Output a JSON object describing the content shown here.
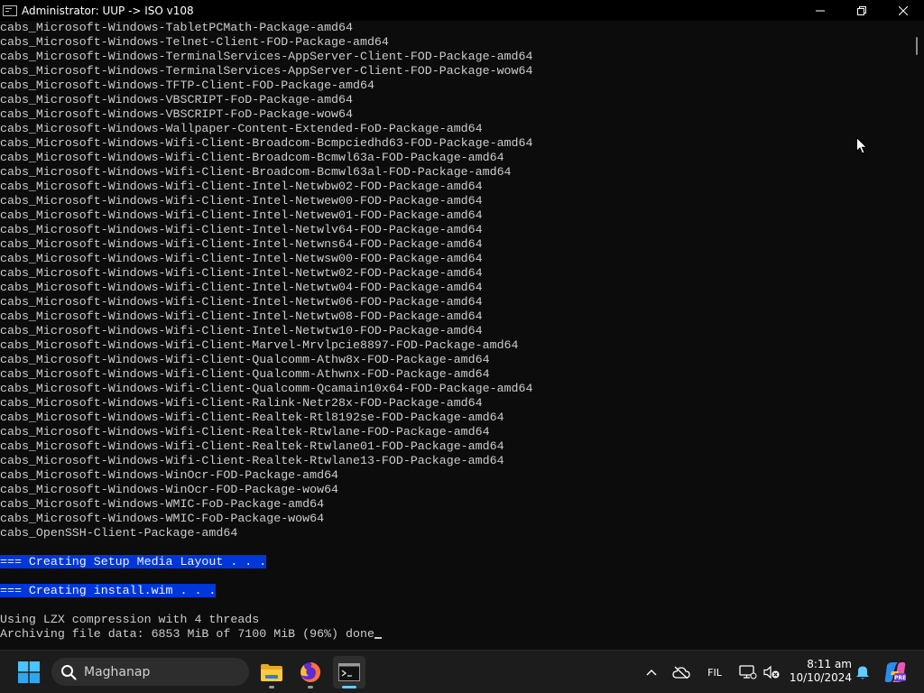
{
  "window": {
    "title": "Administrator:  UUP -> ISO v108"
  },
  "console": {
    "lines": [
      {
        "text": "cabs_Microsoft-Windows-TabletPCMath-Package-amd64",
        "highlight": false
      },
      {
        "text": "cabs_Microsoft-Windows-Telnet-Client-FOD-Package-amd64",
        "highlight": false
      },
      {
        "text": "cabs_Microsoft-Windows-TerminalServices-AppServer-Client-FOD-Package-amd64",
        "highlight": false
      },
      {
        "text": "cabs_Microsoft-Windows-TerminalServices-AppServer-Client-FOD-Package-wow64",
        "highlight": false
      },
      {
        "text": "cabs_Microsoft-Windows-TFTP-Client-FOD-Package-amd64",
        "highlight": false
      },
      {
        "text": "cabs_Microsoft-Windows-VBSCRIPT-FoD-Package-amd64",
        "highlight": false
      },
      {
        "text": "cabs_Microsoft-Windows-VBSCRIPT-FoD-Package-wow64",
        "highlight": false
      },
      {
        "text": "cabs_Microsoft-Windows-Wallpaper-Content-Extended-FoD-Package-amd64",
        "highlight": false
      },
      {
        "text": "cabs_Microsoft-Windows-Wifi-Client-Broadcom-Bcmpciedhd63-FOD-Package-amd64",
        "highlight": false
      },
      {
        "text": "cabs_Microsoft-Windows-Wifi-Client-Broadcom-Bcmwl63a-FOD-Package-amd64",
        "highlight": false
      },
      {
        "text": "cabs_Microsoft-Windows-Wifi-Client-Broadcom-Bcmwl63al-FOD-Package-amd64",
        "highlight": false
      },
      {
        "text": "cabs_Microsoft-Windows-Wifi-Client-Intel-Netwbw02-FOD-Package-amd64",
        "highlight": false
      },
      {
        "text": "cabs_Microsoft-Windows-Wifi-Client-Intel-Netwew00-FOD-Package-amd64",
        "highlight": false
      },
      {
        "text": "cabs_Microsoft-Windows-Wifi-Client-Intel-Netwew01-FOD-Package-amd64",
        "highlight": false
      },
      {
        "text": "cabs_Microsoft-Windows-Wifi-Client-Intel-Netwlv64-FOD-Package-amd64",
        "highlight": false
      },
      {
        "text": "cabs_Microsoft-Windows-Wifi-Client-Intel-Netwns64-FOD-Package-amd64",
        "highlight": false
      },
      {
        "text": "cabs_Microsoft-Windows-Wifi-Client-Intel-Netwsw00-FOD-Package-amd64",
        "highlight": false
      },
      {
        "text": "cabs_Microsoft-Windows-Wifi-Client-Intel-Netwtw02-FOD-Package-amd64",
        "highlight": false
      },
      {
        "text": "cabs_Microsoft-Windows-Wifi-Client-Intel-Netwtw04-FOD-Package-amd64",
        "highlight": false
      },
      {
        "text": "cabs_Microsoft-Windows-Wifi-Client-Intel-Netwtw06-FOD-Package-amd64",
        "highlight": false
      },
      {
        "text": "cabs_Microsoft-Windows-Wifi-Client-Intel-Netwtw08-FOD-Package-amd64",
        "highlight": false
      },
      {
        "text": "cabs_Microsoft-Windows-Wifi-Client-Intel-Netwtw10-FOD-Package-amd64",
        "highlight": false
      },
      {
        "text": "cabs_Microsoft-Windows-Wifi-Client-Marvel-Mrvlpcie8897-FOD-Package-amd64",
        "highlight": false
      },
      {
        "text": "cabs_Microsoft-Windows-Wifi-Client-Qualcomm-Athw8x-FOD-Package-amd64",
        "highlight": false
      },
      {
        "text": "cabs_Microsoft-Windows-Wifi-Client-Qualcomm-Athwnx-FOD-Package-amd64",
        "highlight": false
      },
      {
        "text": "cabs_Microsoft-Windows-Wifi-Client-Qualcomm-Qcamain10x64-FOD-Package-amd64",
        "highlight": false
      },
      {
        "text": "cabs_Microsoft-Windows-Wifi-Client-Ralink-Netr28x-FOD-Package-amd64",
        "highlight": false
      },
      {
        "text": "cabs_Microsoft-Windows-Wifi-Client-Realtek-Rtl8192se-FOD-Package-amd64",
        "highlight": false
      },
      {
        "text": "cabs_Microsoft-Windows-Wifi-Client-Realtek-Rtwlane-FOD-Package-amd64",
        "highlight": false
      },
      {
        "text": "cabs_Microsoft-Windows-Wifi-Client-Realtek-Rtwlane01-FOD-Package-amd64",
        "highlight": false
      },
      {
        "text": "cabs_Microsoft-Windows-Wifi-Client-Realtek-Rtwlane13-FOD-Package-amd64",
        "highlight": false
      },
      {
        "text": "cabs_Microsoft-Windows-WinOcr-FOD-Package-amd64",
        "highlight": false
      },
      {
        "text": "cabs_Microsoft-Windows-WinOcr-FOD-Package-wow64",
        "highlight": false
      },
      {
        "text": "cabs_Microsoft-Windows-WMIC-FoD-Package-amd64",
        "highlight": false
      },
      {
        "text": "cabs_Microsoft-Windows-WMIC-FoD-Package-wow64",
        "highlight": false
      },
      {
        "text": "cabs_OpenSSH-Client-Package-amd64",
        "highlight": false
      },
      {
        "text": "",
        "highlight": false
      },
      {
        "text": "=== Creating Setup Media Layout . . .",
        "highlight": true
      },
      {
        "text": "",
        "highlight": false
      },
      {
        "text": "=== Creating install.wim . . .",
        "highlight": true
      },
      {
        "text": "",
        "highlight": false
      },
      {
        "text": "Using LZX compression with 4 threads",
        "highlight": false
      },
      {
        "text": "Archiving file data: 6853 MiB of 7100 MiB (96%) done",
        "highlight": false,
        "caret": true
      }
    ]
  },
  "taskbar": {
    "search_placeholder": "Maghanap",
    "apps": [
      {
        "name": "file-explorer",
        "icon": "folder-icon",
        "running": true,
        "active": false
      },
      {
        "name": "firefox",
        "icon": "firefox-icon",
        "running": true,
        "active": false
      },
      {
        "name": "command-prompt",
        "icon": "terminal-icon",
        "running": true,
        "active": true
      }
    ],
    "tray": {
      "language": "FIL",
      "time": "8:11 am",
      "date": "10/10/2024"
    }
  },
  "colors": {
    "console_bg": "#0c0c0c",
    "console_fg": "#cccccc",
    "highlight_bg": "#0037da",
    "taskbar_bg": "#1c1c1c",
    "accent": "#60cdff"
  }
}
